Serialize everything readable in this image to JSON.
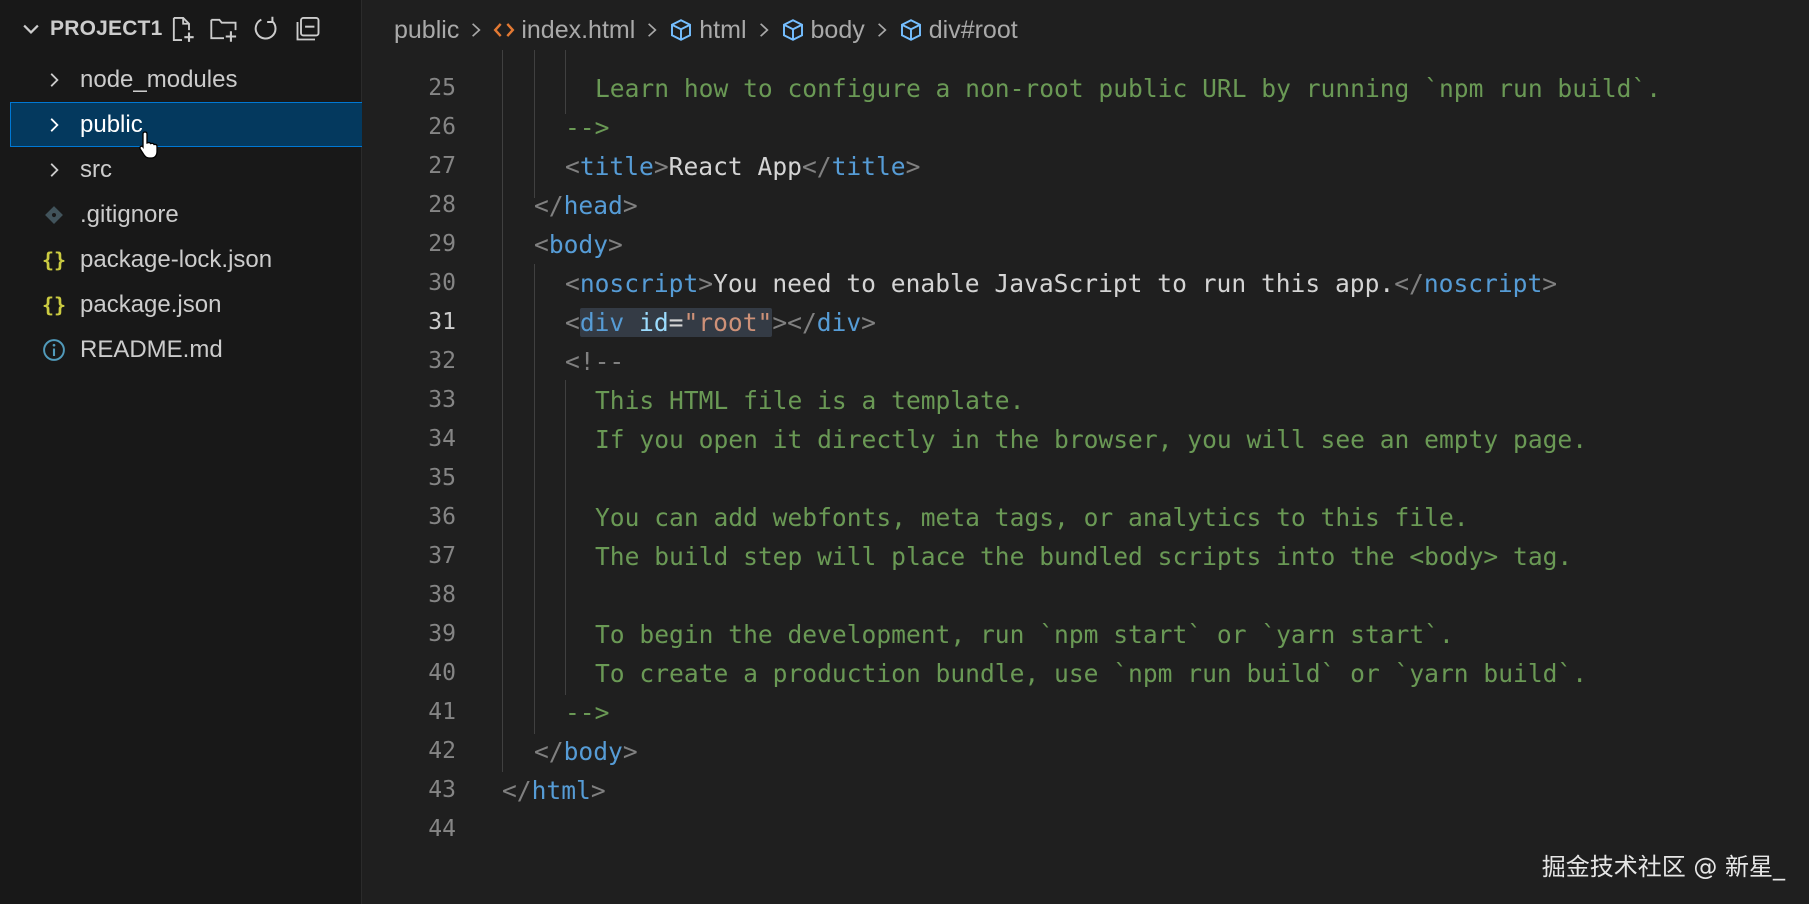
{
  "explorer": {
    "project_name": "PROJECT1",
    "actions": [
      {
        "name": "new-file",
        "icon": "new-file-icon"
      },
      {
        "name": "new-folder",
        "icon": "new-folder-icon"
      },
      {
        "name": "refresh",
        "icon": "refresh-icon"
      },
      {
        "name": "collapse-all",
        "icon": "collapse-all-icon"
      }
    ],
    "items": [
      {
        "label": "node_modules",
        "type": "folder"
      },
      {
        "label": "public",
        "type": "folder",
        "selected": true
      },
      {
        "label": "src",
        "type": "folder"
      },
      {
        "label": ".gitignore",
        "type": "git"
      },
      {
        "label": "package-lock.json",
        "type": "json"
      },
      {
        "label": "package.json",
        "type": "json"
      },
      {
        "label": "README.md",
        "type": "info"
      }
    ]
  },
  "breadcrumb": [
    "public",
    "index.html",
    "html",
    "body",
    "div#root"
  ],
  "editor": {
    "active_line": "31",
    "lines": [
      {
        "n": "25",
        "text": "Learn how to configure a non-root public URL by running `npm run build`."
      },
      {
        "n": "26",
        "text": "-->"
      },
      {
        "n": "27",
        "text": "React App",
        "tag": "title"
      },
      {
        "n": "28",
        "tag": "head"
      },
      {
        "n": "29",
        "tag": "body"
      },
      {
        "n": "30",
        "text": "You need to enable JavaScript to run this app.",
        "tag": "noscript"
      },
      {
        "n": "31",
        "tag": "div",
        "attr": "id",
        "value": "\"root\""
      },
      {
        "n": "32",
        "text": "<!--"
      },
      {
        "n": "33",
        "text": "This HTML file is a template."
      },
      {
        "n": "34",
        "text": "If you open it directly in the browser, you will see an empty page."
      },
      {
        "n": "35",
        "text": ""
      },
      {
        "n": "36",
        "text": "You can add webfonts, meta tags, or analytics to this file."
      },
      {
        "n": "37",
        "text": "The build step will place the bundled scripts into the <body> tag."
      },
      {
        "n": "38",
        "text": ""
      },
      {
        "n": "39",
        "text": "To begin the development, run `npm start` or `yarn start`."
      },
      {
        "n": "40",
        "text": "To create a production bundle, use `npm run build` or `yarn build`."
      },
      {
        "n": "41",
        "text": "-->"
      },
      {
        "n": "42",
        "tag": "body"
      },
      {
        "n": "43",
        "tag": "html"
      },
      {
        "n": "44",
        "text": ""
      }
    ]
  },
  "watermark": "掘金技术社区 @ 新星_"
}
